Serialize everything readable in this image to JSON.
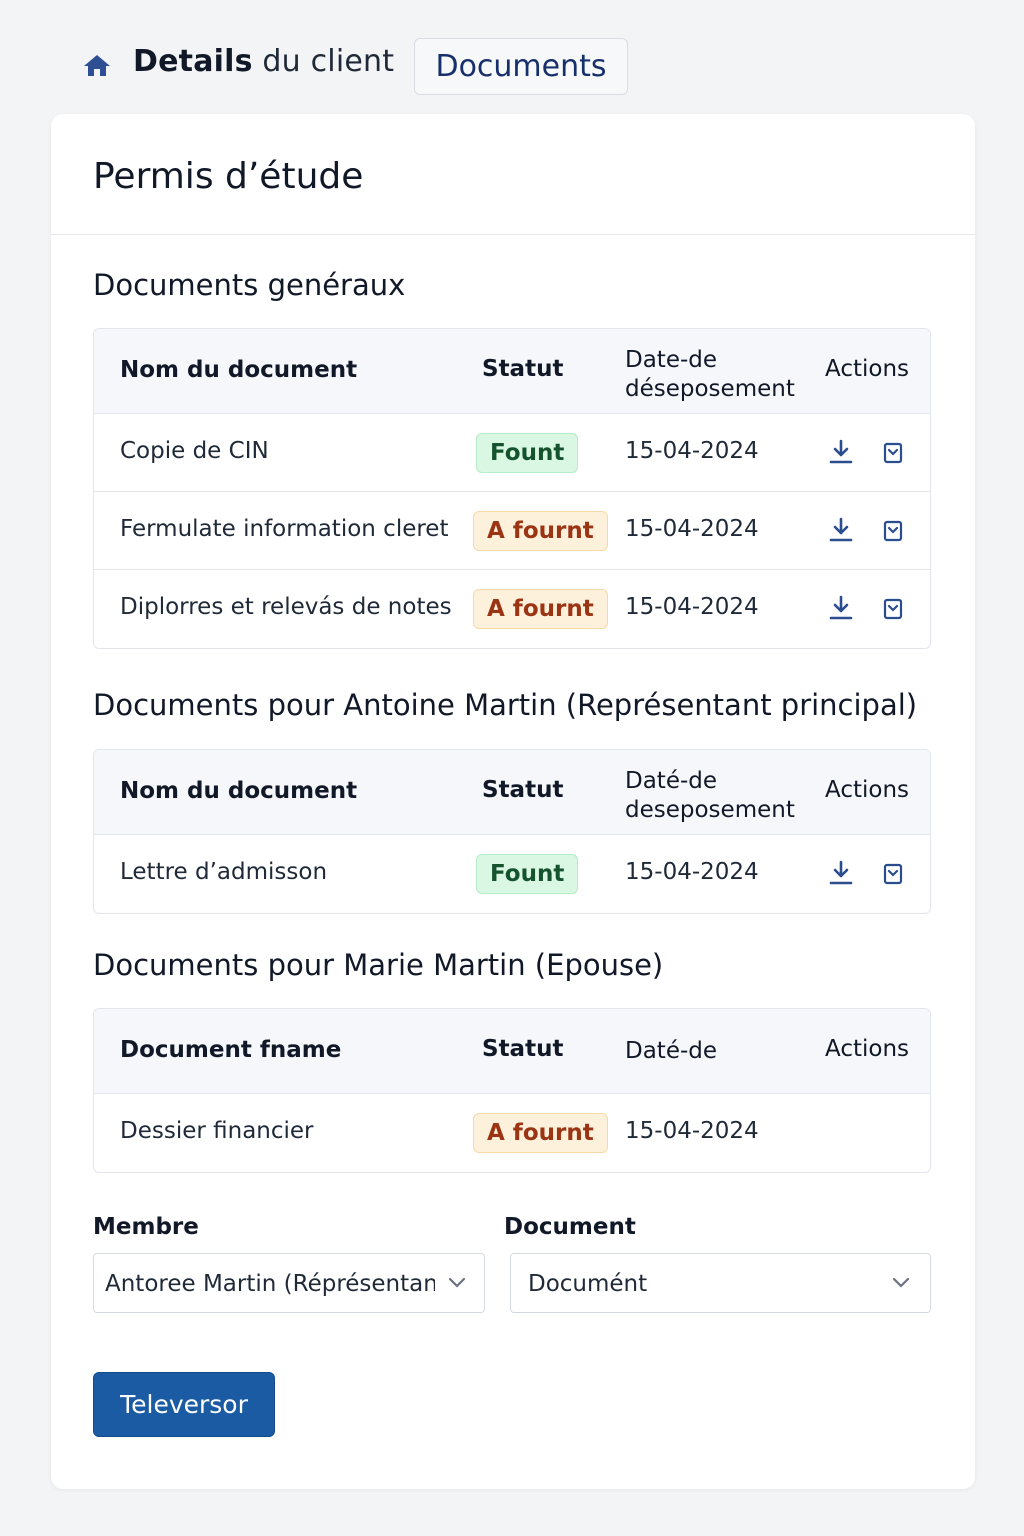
{
  "header": {
    "title_bold": "Details",
    "title_rest": " du client",
    "tab_label": "Documents"
  },
  "card": {
    "title": "Permis d’étude"
  },
  "sections": [
    {
      "title": "Documents genéraux",
      "columns": {
        "name": "Nom du document",
        "status": "Statut",
        "date": "Date-de déseposement",
        "actions": "Actions"
      },
      "rows": [
        {
          "name": "Copie de CIN",
          "status": "Fount",
          "date": "15-04-2024"
        },
        {
          "name": "Fermulate information cleret",
          "status": "A fournt",
          "date": "15-04-2024"
        },
        {
          "name": "Diplorres et relevás de notes",
          "status": "A fournt",
          "date": "15-04-2024"
        }
      ]
    },
    {
      "title": "Documents pour Antoine Martin (Représentant principal)",
      "columns": {
        "name": "Nom du document",
        "status": "Statut",
        "date": "Daté-de deseposement",
        "actions": "Actions"
      },
      "rows": [
        {
          "name": "Lettre d’admisson",
          "status": "Fount",
          "date": "15-04-2024"
        }
      ]
    },
    {
      "title": "Documents pour Marie Martin (Epouse)",
      "columns": {
        "name": "Document fname",
        "status": "Statut",
        "date": "Daté-de",
        "actions": "Actions"
      },
      "rows": [
        {
          "name": "Dessier financier",
          "status": "A fournt",
          "date": "15-04-2024"
        }
      ]
    }
  ],
  "form": {
    "member_label": "Membre",
    "member_value": "Antoree Martin (Réprésentant",
    "document_label": "Document",
    "document_value": "Documént",
    "upload_label": "Televersor"
  },
  "colors": {
    "primary_button": "#1a5ba4",
    "badge_ok_bg": "#d9f7e2",
    "badge_pending_bg": "#fdf1dc",
    "icon": "#2a4d8f"
  },
  "icons": {
    "home": "home-icon",
    "download": "download-icon",
    "file": "file-icon",
    "chevron": "chevron-down-icon"
  }
}
